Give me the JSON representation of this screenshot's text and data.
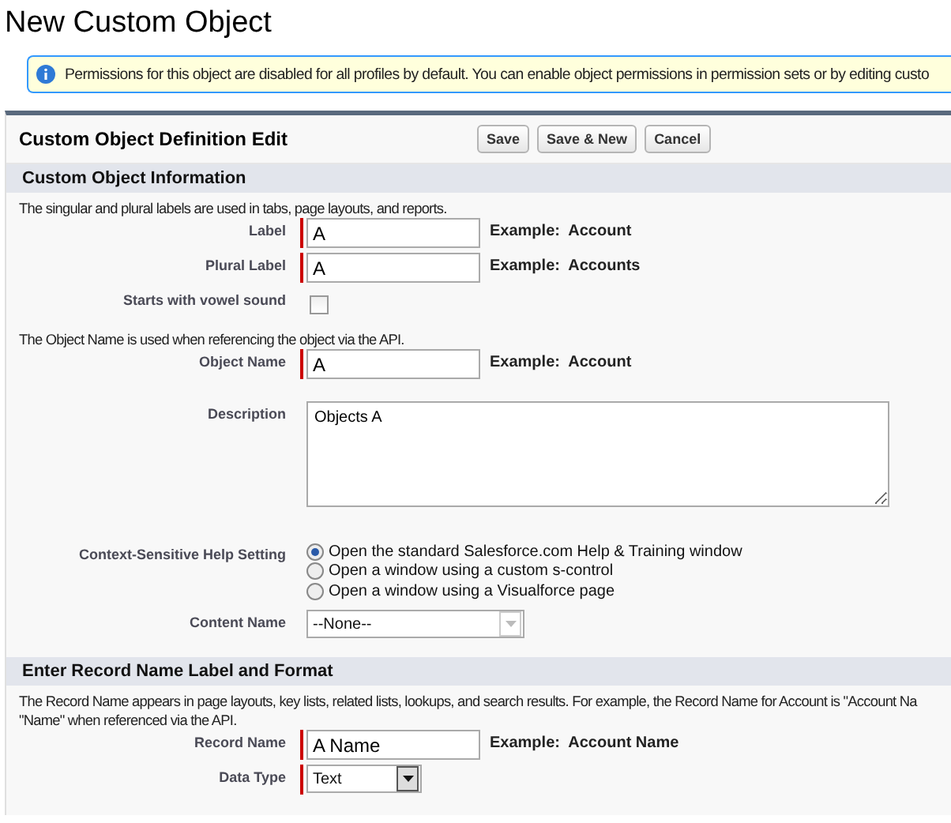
{
  "page_title": "New Custom Object",
  "info_banner": "Permissions for this object are disabled for all profiles by default. You can enable object permissions in permission sets or by editing custo",
  "form": {
    "title": "Custom Object Definition Edit",
    "buttons": [
      "Save",
      "Save & New",
      "Cancel"
    ],
    "sections": [
      {
        "title": "Custom Object Information",
        "rows": [
          {
            "kind": "note",
            "text": "The singular and plural labels are used in tabs, page layouts, and reports."
          },
          {
            "kind": "text",
            "label": "Label",
            "required": true,
            "value": "A",
            "example": "Example:  Account"
          },
          {
            "kind": "text",
            "label": "Plural Label",
            "required": true,
            "value": "A",
            "example": "Example:  Accounts"
          },
          {
            "kind": "checkbox",
            "label": "Starts with vowel sound",
            "checked": false
          },
          {
            "kind": "note",
            "text": "The Object Name is used when referencing the object via the API."
          },
          {
            "kind": "text",
            "label": "Object Name",
            "required": true,
            "value": "A",
            "example": "Example:  Account"
          },
          {
            "kind": "textarea",
            "label": "Description",
            "required": false,
            "value": "Objects A"
          },
          {
            "kind": "radio",
            "label": "Context-Sensitive Help Setting",
            "options": [
              {
                "label": "Open the standard Salesforce.com Help & Training window",
                "selected": true
              },
              {
                "label": "Open a window using a custom s-control",
                "selected": false
              },
              {
                "label": "Open a window using a Visualforce page",
                "selected": false
              }
            ]
          },
          {
            "kind": "select",
            "label": "Content Name",
            "required": false,
            "value": "--None--",
            "disabled": true
          }
        ]
      },
      {
        "title": "Enter Record Name Label and Format",
        "rows": [
          {
            "kind": "note",
            "text": "The Record Name appears in page layouts, key lists, related lists, lookups, and search results. For example, the Record Name for Account is \"Account Na"
          },
          {
            "kind": "note",
            "text": "\"Name\" when referenced via the API."
          },
          {
            "kind": "text",
            "label": "Record Name",
            "required": true,
            "value": "A Name",
            "example": "Example:  Account Name"
          },
          {
            "kind": "select",
            "label": "Data Type",
            "required": true,
            "value": "Text",
            "disabled": false
          }
        ]
      }
    ]
  }
}
